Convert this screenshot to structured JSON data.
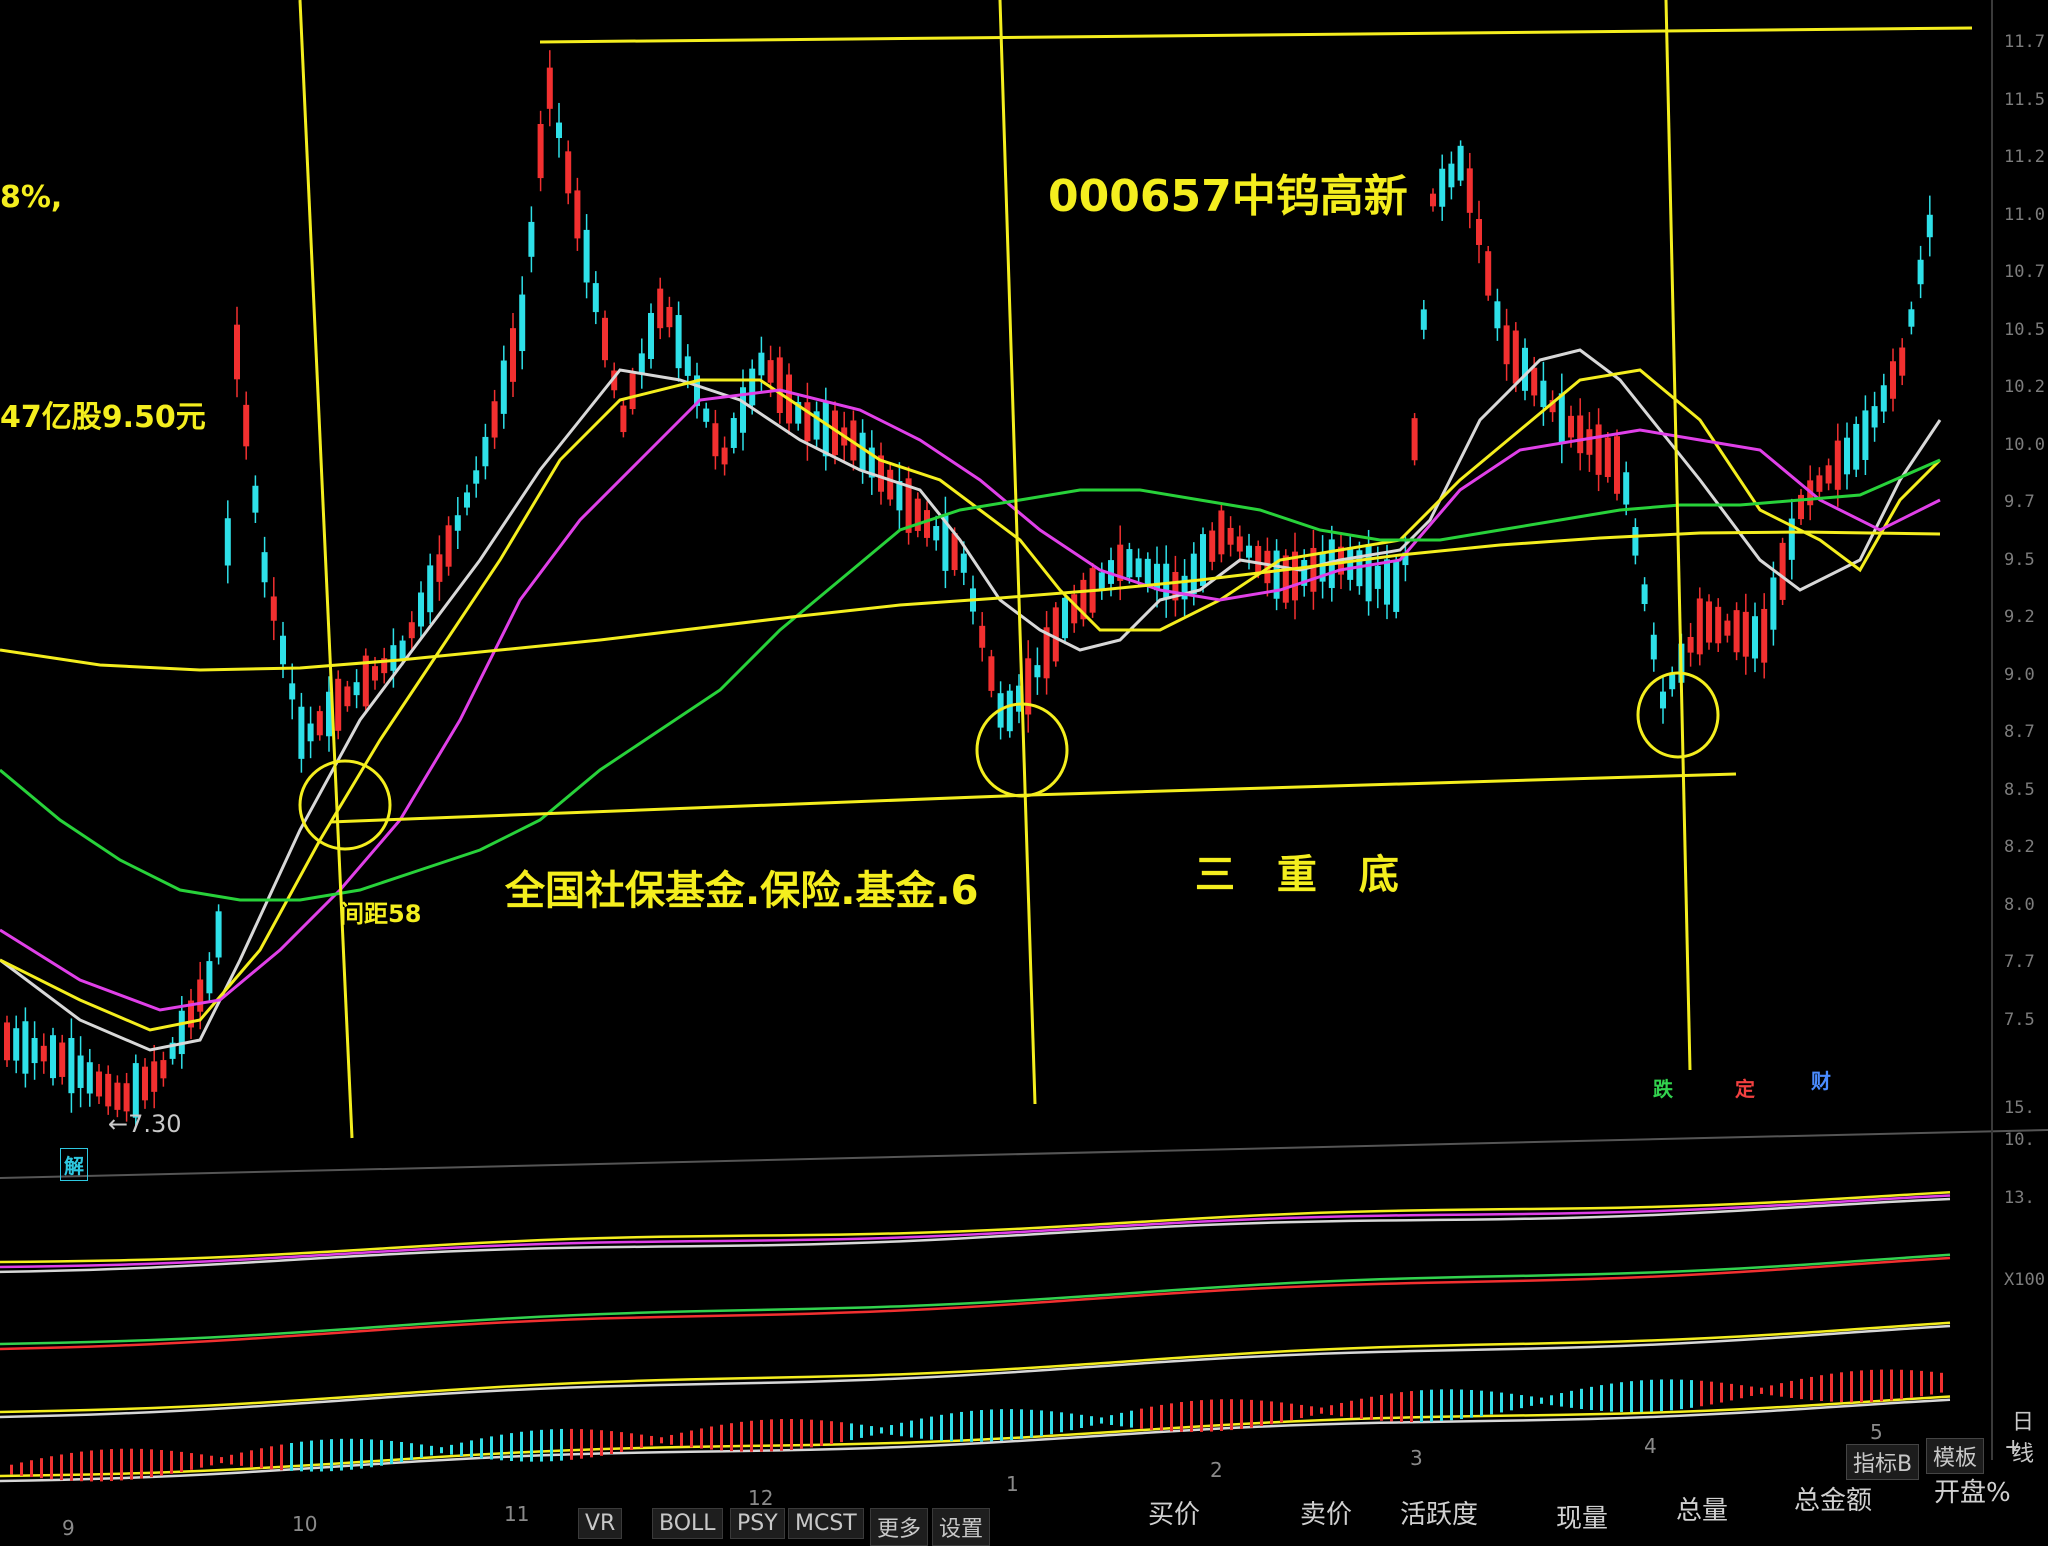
{
  "stock_title": "000657中钨高新",
  "info_left_1": "8%,",
  "info_left_2": "47亿股9.50元",
  "fund_annotation": "全国社保基金.保险.基金.6",
  "pattern_annotation": "三 重 底",
  "gap_annotation": "间距58",
  "low_price_label": "←7.30",
  "markers": {
    "jie": "解",
    "die": "跌",
    "ding": "定",
    "cai": "财"
  },
  "y_axis_labels": [
    "11.7",
    "11.5",
    "11.2",
    "11.0",
    "10.7",
    "10.5",
    "10.2",
    "10.0",
    "9.7",
    "9.5",
    "9.2",
    "9.0",
    "8.7",
    "8.5",
    "8.2",
    "8.0",
    "7.7",
    "7.5"
  ],
  "volume_axis_labels": [
    "15.",
    "10.",
    "13.",
    "X100"
  ],
  "x_axis_labels": [
    "9",
    "10",
    "11",
    "12",
    "1",
    "2",
    "3",
    "4",
    "5"
  ],
  "indicator_tabs": [
    "VR",
    "BOLL",
    "PSY",
    "MCST",
    "更多",
    "设置"
  ],
  "bottom_labels": [
    "买价",
    "卖价",
    "活跃度",
    "现量",
    "总量",
    "总金额",
    "开盘%"
  ],
  "toolbar": {
    "indicator_b": "指标B",
    "template": "模板",
    "plus": "+",
    "daily": "日线"
  },
  "colors": {
    "background": "#000000",
    "up_candle": "#f23030",
    "down_candle": "#2ee0e8",
    "annotation": "#f4ee1e",
    "ma5": "#d8d8d8",
    "ma10": "#f4ee1e",
    "ma20": "#e040e8",
    "ma60": "#28d23a",
    "ma250": "#f4ee1e"
  }
}
